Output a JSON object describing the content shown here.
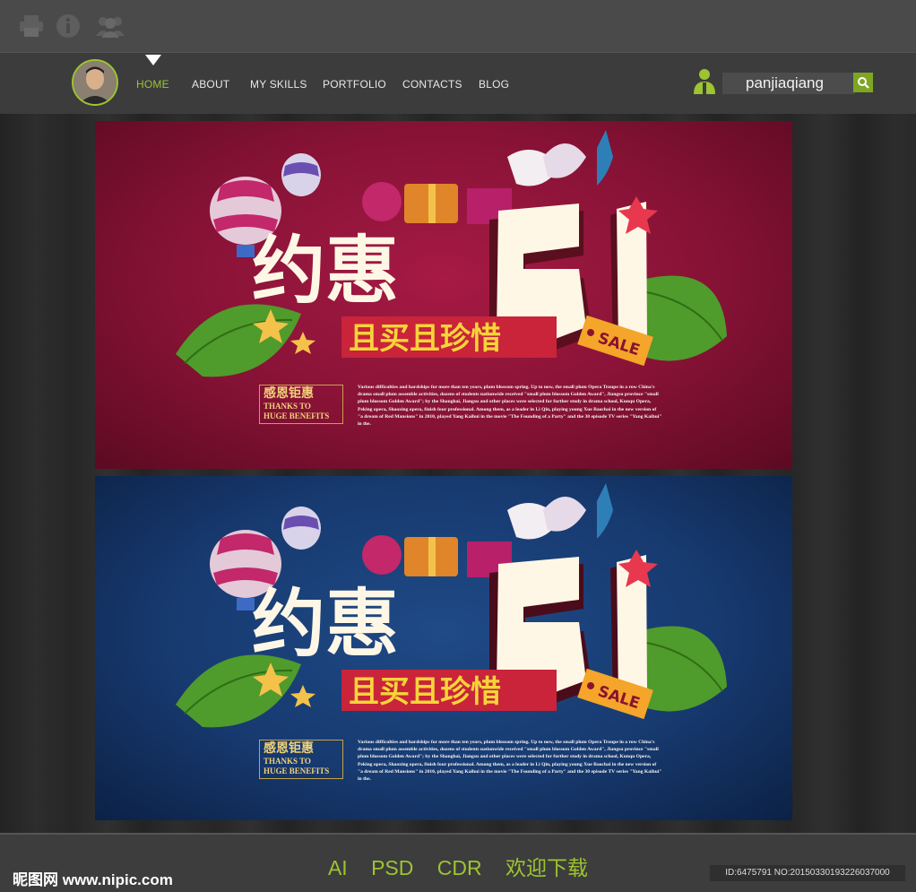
{
  "topbar": {
    "icons": [
      "printer-icon",
      "info-icon",
      "group-icon"
    ]
  },
  "nav": {
    "items": [
      {
        "label": "HOME",
        "active": true
      },
      {
        "label": "ABOUT"
      },
      {
        "label": "MY SKILLS"
      },
      {
        "label": "PORTFOLIO"
      },
      {
        "label": "CONTACTS"
      },
      {
        "label": "BLOG"
      }
    ],
    "search_value": "panjiaqiang",
    "accent": "#9dc431"
  },
  "posters": [
    {
      "theme": "red",
      "title": "约惠",
      "number": "51",
      "subtitle": "且买且珍惜",
      "tag": "SALE",
      "box_cn": "感恩钜惠",
      "box_en1": "THANKS TO",
      "box_en2": "HUGE BENEFITS",
      "paragraph": "Various difficulties and hardships for more than ten years, plum blossom spring. Up to now, the small plum Opera Troupe in a row China's drama small plum assemble activities, dozens of students nationwide received \"small plum blossom Golden Award\", Jiangsu province \"small plum blossom Golden Award\"; by the Shanghai, Jiangsu and other places were selected for further study in drama school, Kunqu Opera, Peking opera, Shaoxing opera, finish four professional. Among them, as a leader in Li Qin, playing young Xue Baochai in the new version of \"a dream of Red Mansions\" in 2010, played Yang Kaihui in the movie \"The Founding of a Party\" and the 30 episode TV series \"Yang Kaihui\" in the."
    },
    {
      "theme": "blue",
      "title": "约惠",
      "number": "51",
      "subtitle": "且买且珍惜",
      "tag": "SALE",
      "box_cn": "感恩钜惠",
      "box_en1": "THANKS TO",
      "box_en2": "HUGE BENEFITS",
      "paragraph": "Various difficulties and hardships for more than ten years, plum blossom spring. Up to now, the small plum Opera Troupe in a row China's drama small plum assemble activities, dozens of students nationwide received \"small plum blossom Golden Award\", Jiangsu province \"small plum blossom Golden Award\"; by the Shanghai, Jiangsu and other places were selected for further study in drama school, Kunqu Opera, Peking opera, Shaoxing opera, finish four professional. Among them, as a leader in Li Qin, playing young Xue Baochai in the new version of \"a dream of Red Mansions\" in 2010, played Yang Kaihui in the movie \"The Founding of a Party\" and the 30 episode TV series \"Yang Kaihui\" in the."
    }
  ],
  "footer": {
    "brand": "昵图网 www.nipic.com",
    "formats": [
      "AI",
      "PSD",
      "CDR",
      "欢迎下载"
    ],
    "id_text": "ID:6475791 NO:20150330193226037000"
  }
}
